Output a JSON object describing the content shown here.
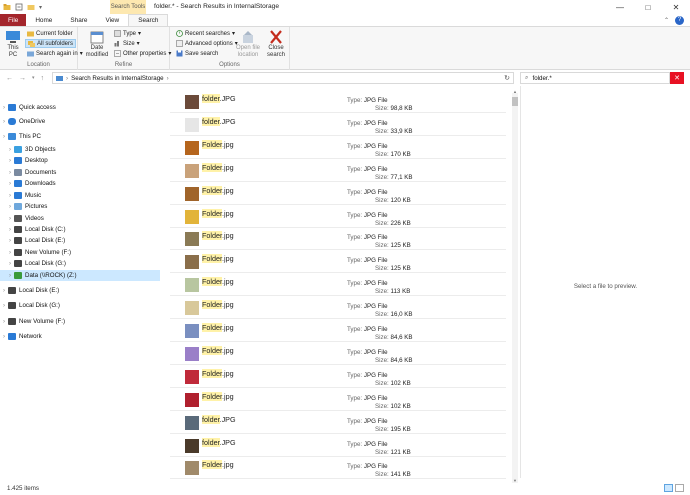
{
  "window": {
    "title": "folder.* - Search Results in InternalStorage",
    "context_tab": "Search Tools",
    "controls": [
      "—",
      "□",
      "✕"
    ]
  },
  "tabs": [
    "File",
    "Home",
    "Share",
    "View",
    "Search"
  ],
  "ribbon": {
    "location": {
      "label": "Location",
      "this_pc": "This PC",
      "current_folder": "Current folder",
      "all_subfolders": "All subfolders",
      "search_again": "Search again in"
    },
    "refine": {
      "label": "Refine",
      "date_modified": "Date modified",
      "kind": "Type",
      "size": "Size",
      "other": "Other properties"
    },
    "options": {
      "label": "Options",
      "recent": "Recent searches",
      "advanced": "Advanced options",
      "save": "Save search",
      "open_location": "Open file location",
      "close": "Close search"
    }
  },
  "address": {
    "path": "Search Results in InternalStorage",
    "search_value": "folder.*"
  },
  "nav": [
    {
      "label": "Quick access",
      "icon": "star-icon",
      "color": "#2a7ad5",
      "level": 0
    },
    {
      "label": "OneDrive",
      "icon": "cloud-icon",
      "color": "#2a7ad5",
      "level": 0
    },
    {
      "label": "This PC",
      "icon": "computer-icon",
      "color": "#3b8ad9",
      "level": 0
    },
    {
      "label": "3D Objects",
      "icon": "cube-icon",
      "color": "#3aa0e0",
      "level": 1
    },
    {
      "label": "Desktop",
      "icon": "desktop-icon",
      "color": "#2a7ad5",
      "level": 1
    },
    {
      "label": "Documents",
      "icon": "document-icon",
      "color": "#7a8aa0",
      "level": 1
    },
    {
      "label": "Downloads",
      "icon": "download-icon",
      "color": "#2a7ad5",
      "level": 1
    },
    {
      "label": "Music",
      "icon": "music-icon",
      "color": "#2a7ad5",
      "level": 1
    },
    {
      "label": "Pictures",
      "icon": "picture-icon",
      "color": "#6fa8dc",
      "level": 1
    },
    {
      "label": "Videos",
      "icon": "video-icon",
      "color": "#555",
      "level": 1
    },
    {
      "label": "Local Disk (C:)",
      "icon": "drive-icon",
      "color": "#444",
      "level": 1
    },
    {
      "label": "Local Disk (E:)",
      "icon": "drive-icon",
      "color": "#444",
      "level": 1
    },
    {
      "label": "New Volume (F:)",
      "icon": "drive-icon",
      "color": "#444",
      "level": 1
    },
    {
      "label": "Local Disk (G:)",
      "icon": "drive-icon",
      "color": "#444",
      "level": 1
    },
    {
      "label": "Data (\\\\ROCK) (Z:)",
      "icon": "network-drive-icon",
      "color": "#3a9a3a",
      "level": 1,
      "selected": true
    },
    {
      "label": "Local Disk (E:)",
      "icon": "drive-icon",
      "color": "#444",
      "level": 0
    },
    {
      "label": "Local Disk (G:)",
      "icon": "drive-icon",
      "color": "#444",
      "level": 0
    },
    {
      "label": "New Volume (F:)",
      "icon": "drive-icon",
      "color": "#444",
      "level": 0
    },
    {
      "label": "Network",
      "icon": "network-icon",
      "color": "#2a7ad5",
      "level": 0
    }
  ],
  "labels": {
    "type": "Type:",
    "size": "Size:"
  },
  "files": [
    {
      "base": "folder",
      "ext": ".JPG",
      "type": "JPG File",
      "size": "98,8 KB",
      "thumb": "#6b4a3a"
    },
    {
      "base": "folder",
      "ext": ".JPG",
      "type": "JPG File",
      "size": "33,9 KB",
      "thumb": "#e6e6e6"
    },
    {
      "base": "Folder",
      "ext": ".jpg",
      "type": "JPG File",
      "size": "170 KB",
      "thumb": "#b5651d"
    },
    {
      "base": "Folder",
      "ext": ".jpg",
      "type": "JPG File",
      "size": "77,1 KB",
      "thumb": "#c9a27a"
    },
    {
      "base": "Folder",
      "ext": ".jpg",
      "type": "JPG File",
      "size": "120 KB",
      "thumb": "#a0642a"
    },
    {
      "base": "Folder",
      "ext": ".jpg",
      "type": "JPG File",
      "size": "226 KB",
      "thumb": "#e2b43a"
    },
    {
      "base": "Folder",
      "ext": ".jpg",
      "type": "JPG File",
      "size": "125 KB",
      "thumb": "#8a7a55"
    },
    {
      "base": "Folder",
      "ext": ".jpg",
      "type": "JPG File",
      "size": "125 KB",
      "thumb": "#8a6e4a"
    },
    {
      "base": "Folder",
      "ext": ".jpg",
      "type": "JPG File",
      "size": "113 KB",
      "thumb": "#b8c6a0"
    },
    {
      "base": "Folder",
      "ext": ".jpg",
      "type": "JPG File",
      "size": "16,0 KB",
      "thumb": "#d8c89a"
    },
    {
      "base": "Folder",
      "ext": ".jpg",
      "type": "JPG File",
      "size": "84,6 KB",
      "thumb": "#7a8fc0"
    },
    {
      "base": "Folder",
      "ext": ".jpg",
      "type": "JPG File",
      "size": "84,6 KB",
      "thumb": "#9a7fc8"
    },
    {
      "base": "Folder",
      "ext": ".jpg",
      "type": "JPG File",
      "size": "102 KB",
      "thumb": "#c02a3a"
    },
    {
      "base": "Folder",
      "ext": ".jpg",
      "type": "JPG File",
      "size": "102 KB",
      "thumb": "#b0202e"
    },
    {
      "base": "folder",
      "ext": ".JPG",
      "type": "JPG File",
      "size": "195 KB",
      "thumb": "#5a6a7a"
    },
    {
      "base": "folder",
      "ext": ".JPG",
      "type": "JPG File",
      "size": "121 KB",
      "thumb": "#4a3a2a"
    },
    {
      "base": "Folder",
      "ext": ".jpg",
      "type": "JPG File",
      "size": "141 KB",
      "thumb": "#a08a6a"
    }
  ],
  "preview": {
    "text": "Select a file to preview."
  },
  "status": {
    "count": "1.425 items"
  },
  "colors": {
    "accent": "#a4262c",
    "selection": "#cce8ff",
    "highlight": "#fff2a8"
  }
}
